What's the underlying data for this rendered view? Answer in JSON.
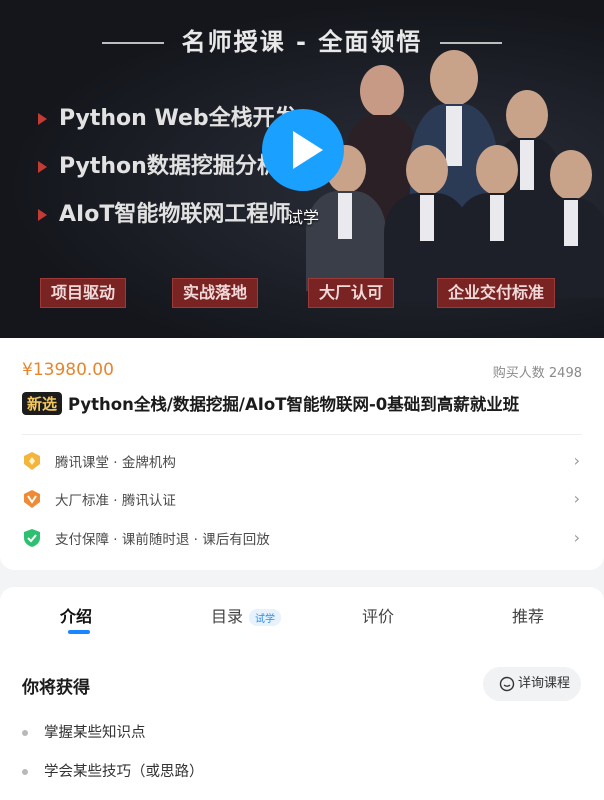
{
  "banner": {
    "headline": "名师授课 - 全面领悟",
    "bullets": [
      "Python Web全栈开发",
      "Python数据挖掘分析",
      "AIoT智能物联网工程师"
    ],
    "tags": [
      "项目驱动",
      "实战落地",
      "大厂认可",
      "企业交付标准"
    ],
    "trial_label": "试学",
    "play_icon": "play-icon"
  },
  "course": {
    "price": "¥13980.00",
    "buyers": "购买人数 2498",
    "badge": "新选",
    "title": "Python全栈/数据挖掘/AIoT智能物联网-0基础到高薪就业班"
  },
  "features": [
    {
      "icon": "gold-shield-icon",
      "text": "腾讯课堂 · 金牌机构"
    },
    {
      "icon": "v-badge-icon",
      "text": "大厂标准 · 腾讯认证"
    },
    {
      "icon": "green-shield-icon",
      "text": "支付保障 · 课前随时退 · 课后有回放"
    }
  ],
  "tabs": {
    "intro": "介绍",
    "catalog": "目录",
    "catalog_badge": "试学",
    "reviews": "评价",
    "recommend": "推荐"
  },
  "gain": {
    "title": "你将获得",
    "consult_label": "详询课程",
    "items": [
      "掌握某些知识点",
      "学会某些技巧（或思路）"
    ]
  },
  "colors": {
    "accent_blue": "#1a86ff",
    "price_orange": "#e6862d",
    "tag_red": "#7a2323"
  }
}
